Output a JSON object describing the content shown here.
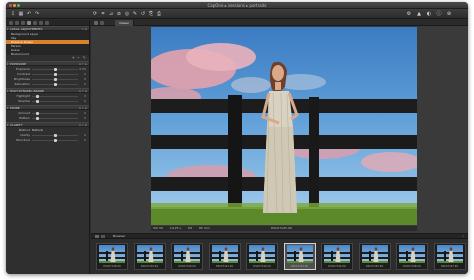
{
  "window": {
    "title": "CapOne ▸ sessions ▸ portraits"
  },
  "toolbar": {
    "icons": [
      "import-icon",
      "grid-icon",
      "undo-icon",
      "redo-icon",
      "rotate-icon",
      "crop-icon",
      "straighten-icon",
      "keystone-icon",
      "spot-icon",
      "picker-icon",
      "reset-icon",
      "copy-icon",
      "apply-icon"
    ]
  },
  "sidebar": {
    "layers_header": "Local Adjustments",
    "layers": [
      "Background Layer",
      "Sky",
      "Dress & Knees",
      "Person",
      "Grass",
      "Background"
    ],
    "selected_layer": 2,
    "exposure": {
      "header": "Exposure",
      "rows": [
        {
          "label": "Exposure",
          "value": "0.00",
          "pos": 0.5
        },
        {
          "label": "Contrast",
          "value": "0",
          "pos": 0.5
        },
        {
          "label": "Brightness",
          "value": "0",
          "pos": 0.5
        },
        {
          "label": "Saturation",
          "value": "0",
          "pos": 0.5
        }
      ]
    },
    "hdr": {
      "header": "High Dynamic Range",
      "rows": [
        {
          "label": "Highlight",
          "value": "0",
          "pos": 0.1
        },
        {
          "label": "Shadow",
          "value": "0",
          "pos": 0.1
        }
      ]
    },
    "moire": {
      "header": "Moiré",
      "rows": [
        {
          "label": "Amount",
          "value": "0",
          "pos": 0.1
        },
        {
          "label": "Pattern",
          "value": "0",
          "pos": 0.1
        }
      ]
    },
    "clarity": {
      "header": "Clarity",
      "rows": [
        {
          "label": "Method",
          "value": "Natural",
          "pos": -1
        },
        {
          "label": "Clarity",
          "value": "0",
          "pos": 0.5
        },
        {
          "label": "Structure",
          "value": "0",
          "pos": 0.5
        }
      ]
    }
  },
  "viewer": {
    "tab": "Viewer",
    "info_left": [
      "ISO 50",
      "1/125 s",
      "f/8",
      "85 mm"
    ],
    "info_center": "DSC07145.IIQ"
  },
  "browser": {
    "title": "Browser",
    "thumbs": [
      "DSC07138.IIQ",
      "DSC07139.IIQ",
      "DSC07140.IIQ",
      "DSC07141.IIQ",
      "DSC07142.IIQ",
      "DSC07143.IIQ",
      "DSC07144.IIQ",
      "DSC07145.IIQ",
      "DSC07146.IIQ",
      "DSC07147.IIQ"
    ],
    "selected": 5
  }
}
